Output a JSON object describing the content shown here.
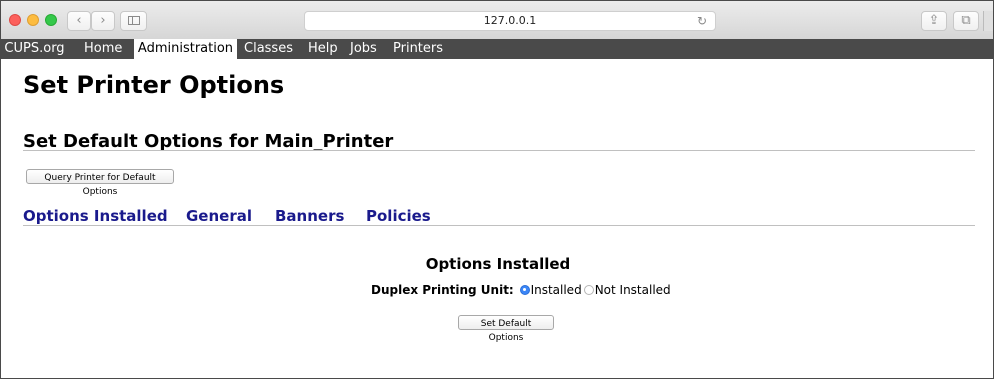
{
  "browser": {
    "back_glyph": "‹",
    "forward_glyph": "›",
    "url": "127.0.0.1",
    "reload_glyph": "↻",
    "share_glyph": "⇪",
    "tabs_glyph": "⧉"
  },
  "nav": {
    "items": [
      {
        "label": "CUPS.org",
        "active": false
      },
      {
        "label": "Home",
        "active": false
      },
      {
        "label": "Administration",
        "active": true
      },
      {
        "label": "Classes",
        "active": false
      },
      {
        "label": "Help",
        "active": false
      },
      {
        "label": "Jobs",
        "active": false
      },
      {
        "label": "Printers",
        "active": false
      }
    ]
  },
  "page": {
    "title": "Set Printer Options",
    "subtitle": "Set Default Options for Main_Printer",
    "query_button": "Query Printer for Default Options",
    "tabs": [
      "Options Installed",
      "General",
      "Banners",
      "Policies"
    ],
    "section_title": "Options Installed",
    "option": {
      "label": "Duplex Printing Unit:",
      "choices": [
        "Installed",
        "Not Installed"
      ],
      "selected": "Installed"
    },
    "submit_button": "Set Default Options"
  },
  "colors": {
    "nav_bg": "#4a4a4a",
    "link": "#1a1a8c",
    "radio_selected": "#3b86f7"
  }
}
